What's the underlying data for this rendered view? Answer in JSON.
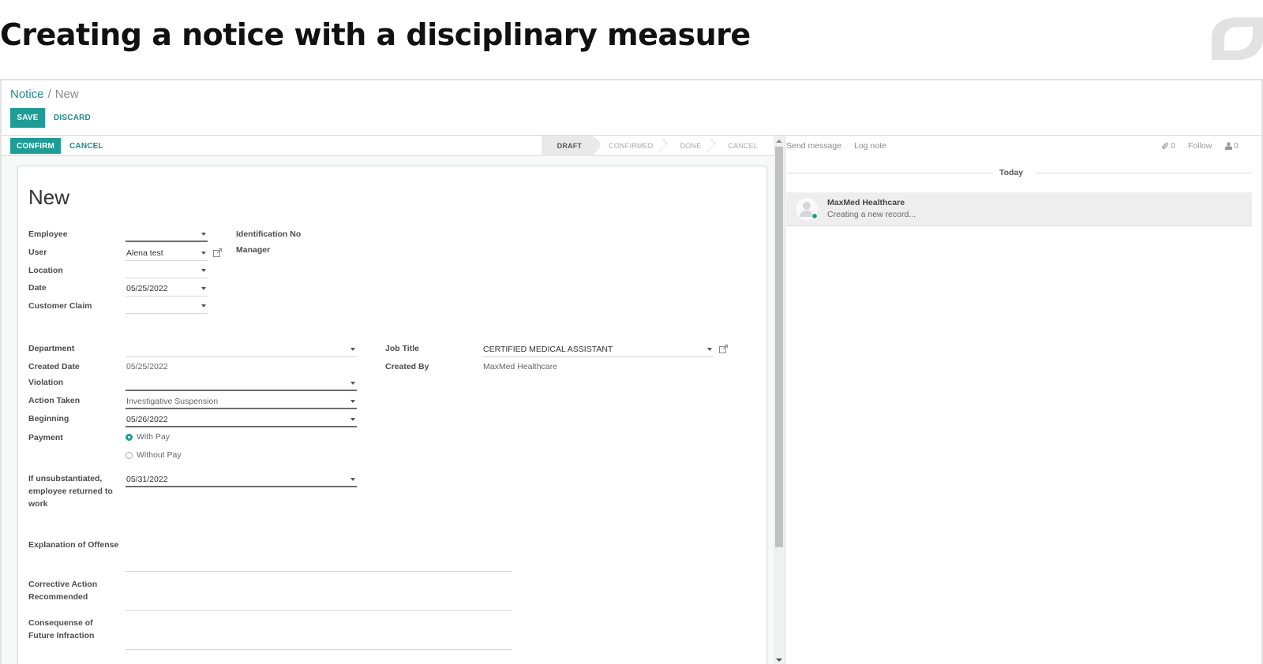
{
  "slide": {
    "title": "Creating a notice with a disciplinary measure"
  },
  "breadcrumb": {
    "parent": "Notice",
    "separator": "/",
    "current": "New"
  },
  "control_panel": {
    "save_label": "SAVE",
    "discard_label": "DISCARD"
  },
  "statusbar": {
    "confirm_label": "CONFIRM",
    "cancel_label": "CANCEL",
    "stages": [
      {
        "label": "DRAFT",
        "active": true
      },
      {
        "label": "CONFIRMED",
        "active": false
      },
      {
        "label": "DONE",
        "active": false
      },
      {
        "label": "CANCEL",
        "active": false
      }
    ]
  },
  "form": {
    "record_title": "New",
    "top_left_fields": [
      {
        "label": "Employee",
        "value": "",
        "type": "many2one"
      },
      {
        "label": "User",
        "value": "Alena test",
        "type": "many2one",
        "external_link": true
      },
      {
        "label": "Location",
        "value": "",
        "type": "many2one"
      },
      {
        "label": "Date",
        "value": "05/25/2022",
        "type": "date"
      },
      {
        "label": "Customer Claim",
        "value": "",
        "type": "many2one"
      }
    ],
    "top_right_fields": [
      {
        "label": "Identification No",
        "value": ""
      },
      {
        "label": "Manager",
        "value": ""
      }
    ],
    "department": {
      "label": "Department",
      "value": ""
    },
    "created_date": {
      "label": "Created Date",
      "value": "05/25/2022"
    },
    "violation": {
      "label": "Violation",
      "value": ""
    },
    "action_taken": {
      "label": "Action Taken",
      "value": "Investigative Suspension"
    },
    "beginning": {
      "label": "Beginning",
      "value": "05/26/2022"
    },
    "payment": {
      "label": "Payment",
      "options": [
        {
          "label": "With Pay",
          "checked": true
        },
        {
          "label": "Without Pay",
          "checked": false
        }
      ]
    },
    "return_to_work": {
      "label_line1": "If unsubstantiated,",
      "label_line2": "employee returned to",
      "label_line3": "work",
      "value": "05/31/2022"
    },
    "job_title": {
      "label": "Job Title",
      "value": "CERTIFIED MEDICAL ASSISTANT"
    },
    "created_by": {
      "label": "Created By",
      "value": "MaxMed Healthcare"
    },
    "explanation": {
      "label": "Explanation of Offense",
      "value": ""
    },
    "corrective_action": {
      "label_line1": "Corrective Action",
      "label_line2": "Recommended",
      "value": ""
    },
    "consequence": {
      "label_line1": "Consequense of",
      "label_line2": "Future Infraction",
      "value": ""
    }
  },
  "chatter": {
    "send_message_label": "Send message",
    "log_note_label": "Log note",
    "attachments_count": "0",
    "follow_label": "Follow",
    "followers_count": "0",
    "date_separator": "Today",
    "messages": [
      {
        "author": "MaxMed Healthcare",
        "body": "Creating a new record...",
        "online": true
      }
    ]
  },
  "colors": {
    "accent": "#1f9c96",
    "link": "#1f8a87",
    "online_dot": "#1a9c8c"
  }
}
